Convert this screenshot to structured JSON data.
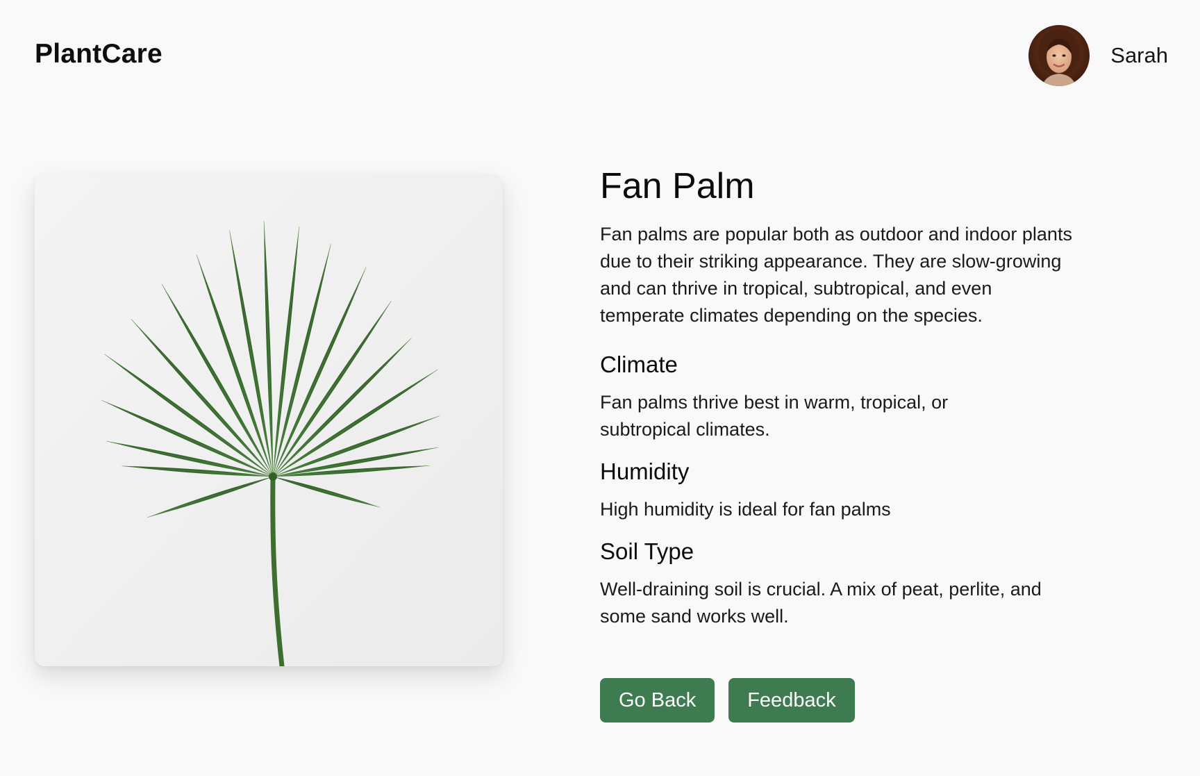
{
  "header": {
    "logo": "PlantCare",
    "user": {
      "name": "Sarah",
      "avatar": "user-avatar-photo"
    }
  },
  "plant": {
    "image": "fan-palm-leaf-photo",
    "name": "Fan Palm",
    "description": "Fan palms are popular both as outdoor and indoor plants due to their striking appearance. They are slow-growing and can thrive in tropical, subtropical, and even temperate climates depending on the species.",
    "sections": [
      {
        "title": "Climate",
        "text": "Fan palms thrive best in warm, tropical, or subtropical climates."
      },
      {
        "title": "Humidity",
        "text": "High humidity is ideal for fan palms"
      },
      {
        "title": "Soil Type",
        "text": "Well-draining soil is crucial. A mix of peat, perlite, and some sand works well."
      }
    ]
  },
  "actions": {
    "go_back_label": "Go Back",
    "feedback_label": "Feedback"
  },
  "colors": {
    "background": "#f9f9f9",
    "button": "#3f7b50",
    "leaf": "#3b6b2e"
  }
}
